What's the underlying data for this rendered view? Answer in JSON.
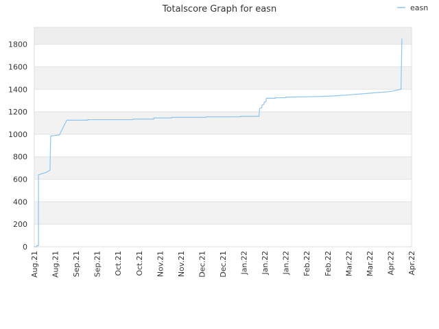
{
  "chart_data": {
    "type": "line",
    "title": "Totalscore Graph for easn",
    "xlabel": "",
    "ylabel": "",
    "x_tick_labels": [
      "Aug.21",
      "Aug.21",
      "Sep.21",
      "Sep.21",
      "Oct.21",
      "Oct.21",
      "Nov.21",
      "Nov.21",
      "Dec.21",
      "Dec.21",
      "Jan.22",
      "Jan.22",
      "Jan.22",
      "Feb.22",
      "Feb.22",
      "Mar.22",
      "Mar.22",
      "Apr.22",
      "Apr.22"
    ],
    "y_ticks": [
      0,
      200,
      400,
      600,
      800,
      1000,
      1200,
      1400,
      1600,
      1800
    ],
    "ylim": [
      0,
      1950
    ],
    "grid": true,
    "alternating_bands": true,
    "legend": {
      "position": "top-right"
    },
    "series": [
      {
        "name": "easn",
        "color": "#8cc4f0",
        "points": [
          [
            0.0,
            0
          ],
          [
            0.12,
            0
          ],
          [
            0.12,
            10
          ],
          [
            0.2,
            10
          ],
          [
            0.2,
            640
          ],
          [
            0.55,
            660
          ],
          [
            0.75,
            680
          ],
          [
            0.78,
            985
          ],
          [
            1.0,
            990
          ],
          [
            1.2,
            995
          ],
          [
            1.55,
            1125
          ],
          [
            2.55,
            1125
          ],
          [
            2.55,
            1130
          ],
          [
            4.7,
            1130
          ],
          [
            4.7,
            1135
          ],
          [
            5.7,
            1135
          ],
          [
            5.7,
            1145
          ],
          [
            6.55,
            1145
          ],
          [
            6.55,
            1150
          ],
          [
            8.2,
            1150
          ],
          [
            8.2,
            1155
          ],
          [
            9.85,
            1155
          ],
          [
            9.85,
            1160
          ],
          [
            10.72,
            1160
          ],
          [
            10.72,
            1165
          ],
          [
            10.75,
            1230
          ],
          [
            10.85,
            1235
          ],
          [
            10.87,
            1260
          ],
          [
            10.95,
            1265
          ],
          [
            10.97,
            1285
          ],
          [
            11.05,
            1290
          ],
          [
            11.07,
            1320
          ],
          [
            11.5,
            1320
          ],
          [
            11.5,
            1325
          ],
          [
            12.0,
            1325
          ],
          [
            12.0,
            1330
          ],
          [
            13.4,
            1335
          ],
          [
            14.2,
            1340
          ],
          [
            15.0,
            1350
          ],
          [
            16.0,
            1365
          ],
          [
            17.0,
            1380
          ],
          [
            17.5,
            1400
          ],
          [
            17.5,
            1420
          ],
          [
            17.52,
            1650
          ],
          [
            17.54,
            1850
          ]
        ]
      }
    ]
  }
}
